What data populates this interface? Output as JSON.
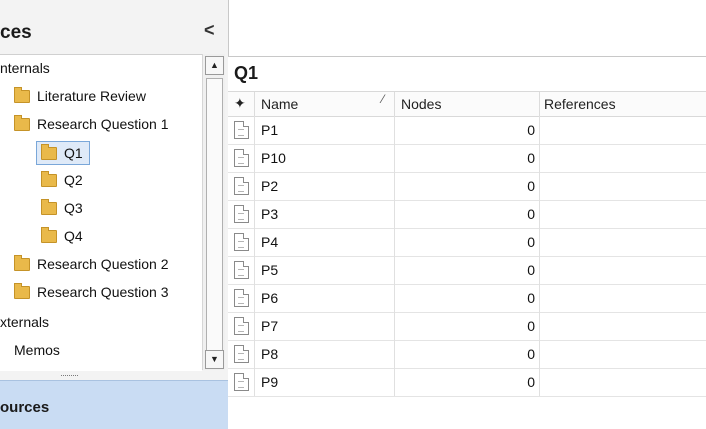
{
  "nav": {
    "title": "ces",
    "collapse_glyph": "<",
    "tree": [
      {
        "label": "nternals",
        "icon": ""
      },
      {
        "label": "Literature Review",
        "icon": "folder"
      },
      {
        "label": "Research Question 1",
        "icon": "folder"
      },
      {
        "label": "Q1",
        "icon": "folder",
        "selected": true
      },
      {
        "label": "Q2",
        "icon": "folder"
      },
      {
        "label": "Q3",
        "icon": "folder"
      },
      {
        "label": "Q4",
        "icon": "folder"
      },
      {
        "label": "Research Question 2",
        "icon": "folder"
      },
      {
        "label": "Research Question 3",
        "icon": "folder"
      },
      {
        "label": "xternals",
        "icon": ""
      },
      {
        "label": "Memos",
        "icon": ""
      }
    ],
    "scroll_up": "▲",
    "scroll_down": "▼",
    "grip": "·········",
    "footer_label": "ources"
  },
  "main": {
    "title": "Q1",
    "columns": {
      "name": "Name",
      "nodes": "Nodes",
      "references": "References"
    },
    "sort_glyph": "⁄",
    "pin_glyph": "✦",
    "rows": [
      {
        "name": "P1",
        "nodes": "0"
      },
      {
        "name": "P10",
        "nodes": "0"
      },
      {
        "name": "P2",
        "nodes": "0"
      },
      {
        "name": "P3",
        "nodes": "0"
      },
      {
        "name": "P4",
        "nodes": "0"
      },
      {
        "name": "P5",
        "nodes": "0"
      },
      {
        "name": "P6",
        "nodes": "0"
      },
      {
        "name": "P7",
        "nodes": "0"
      },
      {
        "name": "P8",
        "nodes": "0"
      },
      {
        "name": "P9",
        "nodes": "0"
      }
    ]
  },
  "colors": {
    "accent": "#c9dcf3",
    "folder": "#e9b94a",
    "selection": "#dfeaf8"
  }
}
